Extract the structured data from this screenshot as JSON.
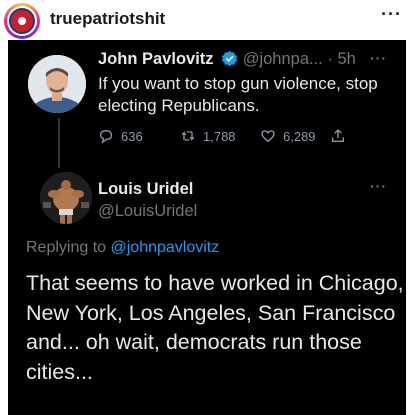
{
  "instagram": {
    "username": "truepatriotshit",
    "more_label": "···"
  },
  "tweet": {
    "author_name": "John Pavlovitz",
    "author_handle": "@johnpa...",
    "separator": " · ",
    "time": "5h",
    "text": "If you want to stop gun violence, stop electing Republicans.",
    "more_label": "···",
    "replies": "636",
    "retweets": "1,788",
    "likes": "6,289"
  },
  "reply": {
    "author_name": "Louis Uridel",
    "author_handle": "@LouisUridel",
    "more_label": "···",
    "replying_to_prefix": "Replying to ",
    "replying_to_handle": "@johnpavlovitz",
    "text": "That seems to have worked in Chicago, New York, Los Angeles, San Francisco and... oh wait, democrats run those cities..."
  },
  "colors": {
    "background": "#000000",
    "text": "#e7e9ea",
    "muted": "#71767b",
    "link": "#1d9bf0",
    "verified": "#1d9bf0"
  }
}
